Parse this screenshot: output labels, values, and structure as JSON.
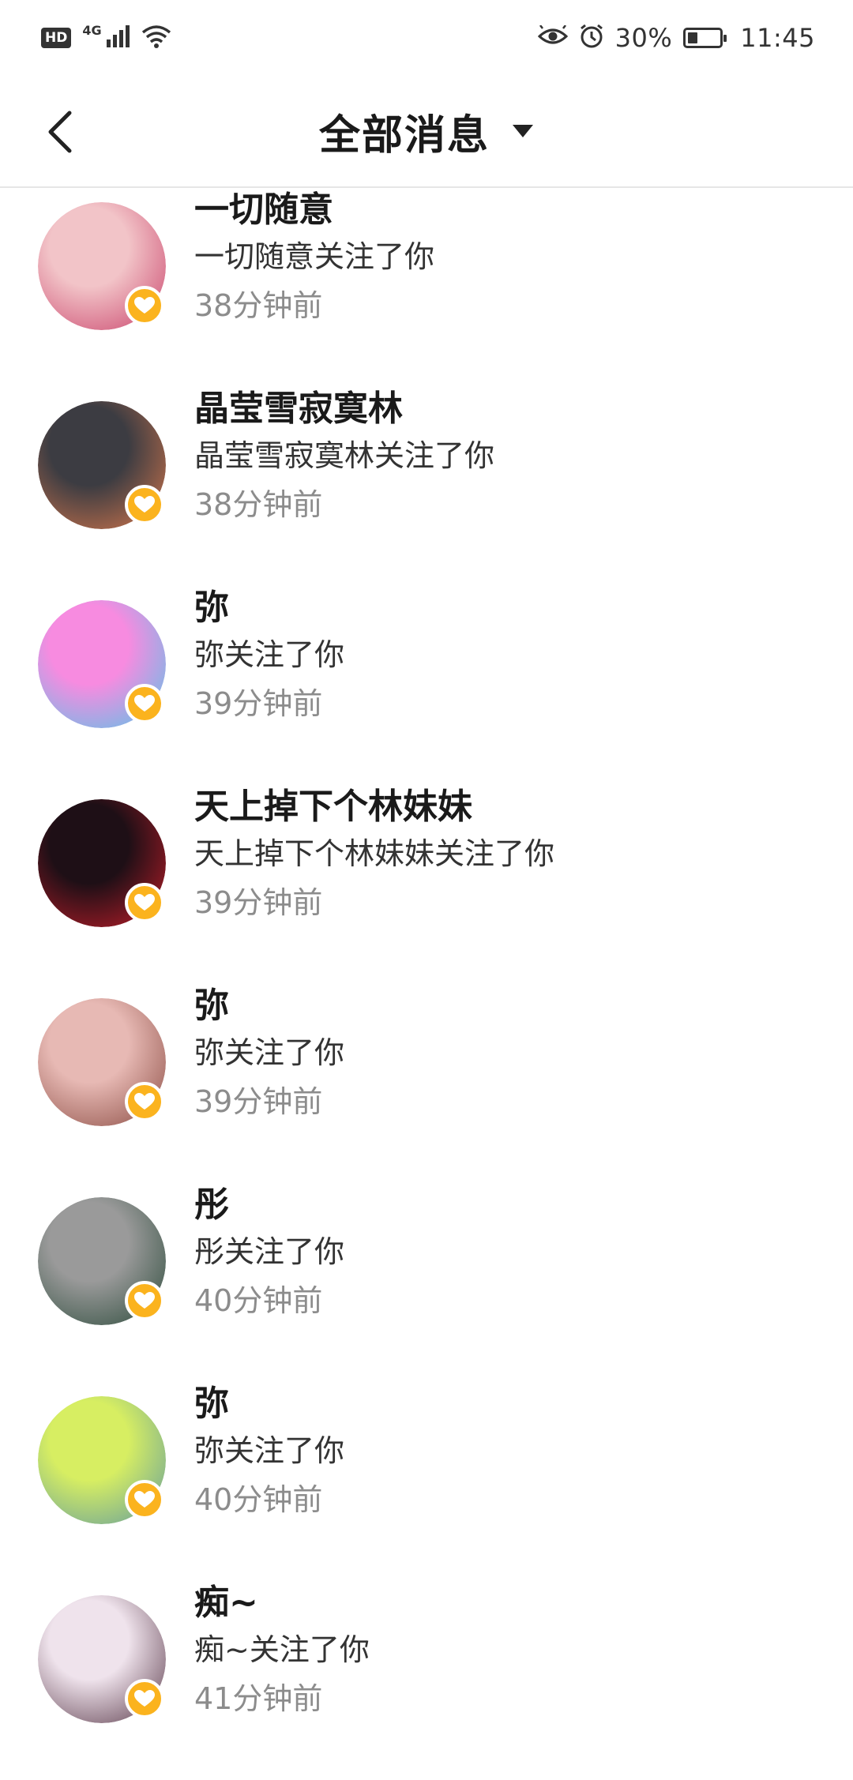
{
  "status_bar": {
    "hd_label": "HD",
    "network_label": "4G",
    "signal_icon": "signal-icon",
    "wifi_icon": "wifi-icon",
    "eye_icon": "eye-icon",
    "alarm_icon": "alarm-icon",
    "battery_percent": "30%",
    "battery_level": 0.3,
    "time": "11:45"
  },
  "header": {
    "back_icon": "chevron-left-icon",
    "title": "全部消息",
    "dropdown_icon": "caret-down-icon"
  },
  "accent_color": "#fbb31e",
  "messages": [
    {
      "name": "一切随意",
      "action": "一切随意关注了你",
      "time": "38分钟前",
      "avatar_colors": [
        "#f2c4c8",
        "#c9426a"
      ]
    },
    {
      "name": "晶莹雪寂寞林",
      "action": "晶莹雪寂寞林关注了你",
      "time": "38分钟前",
      "avatar_colors": [
        "#3c3c42",
        "#d9784c"
      ]
    },
    {
      "name": "弥",
      "action": "弥关注了你",
      "time": "39分钟前",
      "avatar_colors": [
        "#f78be0",
        "#53c6e8"
      ]
    },
    {
      "name": "天上掉下个林妹妹",
      "action": "天上掉下个林妹妹关注了你",
      "time": "39分钟前",
      "avatar_colors": [
        "#1e0f16",
        "#c41e2a"
      ]
    },
    {
      "name": "弥",
      "action": "弥关注了你",
      "time": "39分钟前",
      "avatar_colors": [
        "#e7b9b4",
        "#8a4b42"
      ]
    },
    {
      "name": "彤",
      "action": "彤关注了你",
      "time": "40分钟前",
      "avatar_colors": [
        "#9a9a9a",
        "#2b4a3a"
      ]
    },
    {
      "name": "弥",
      "action": "弥关注了你",
      "time": "40分钟前",
      "avatar_colors": [
        "#d7ee62",
        "#5f9aa0"
      ]
    },
    {
      "name": "痴~",
      "action": "痴~关注了你",
      "time": "41分钟前",
      "avatar_colors": [
        "#efe3ec",
        "#5a3a4a"
      ]
    }
  ]
}
